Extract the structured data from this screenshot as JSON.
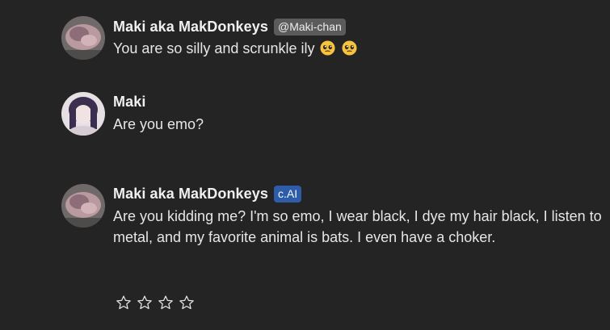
{
  "messages": [
    {
      "author": "Maki aka MakDonkeys",
      "tag": "@Maki-chan",
      "text": "You are so silly and scrunkle ily",
      "emojis": [
        "pleading-face-emoji",
        "pleading-face-emoji"
      ]
    },
    {
      "author": "Maki",
      "text": "Are you emo?"
    },
    {
      "author": "Maki aka MakDonkeys",
      "tag": "c.AI",
      "text_line1": "Are you kidding me? I'm so emo, I wear black, I dye my hair black, I listen to",
      "text_line2": "metal, and my favorite animal is bats. I even have a choker."
    }
  ],
  "rating": {
    "stars_total": 4,
    "stars_filled": 0,
    "icon": "star-outline-icon"
  },
  "colors": {
    "background": "#242424",
    "handle_tag": "#5b5b5b",
    "cai_tag": "#2e5ca9"
  }
}
